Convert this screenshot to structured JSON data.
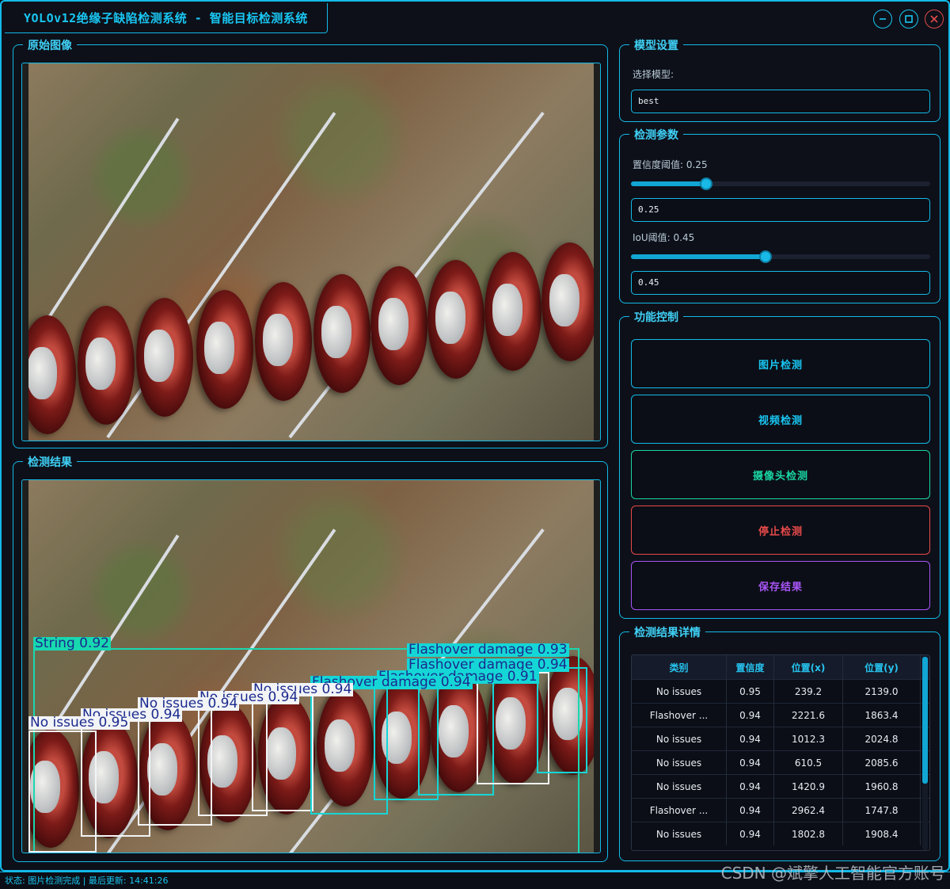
{
  "window": {
    "title": "YOLOv12绝缘子缺陷检测系统 - 智能目标检测系统"
  },
  "left": {
    "original_title": "原始图像",
    "result_title": "检测结果",
    "detections": [
      {
        "label": "String 0.92",
        "style": "mint"
      },
      {
        "label": "Flashover damage 0.93",
        "style": "cyan"
      },
      {
        "label": "Flashover damage 0.94",
        "style": "cyan"
      },
      {
        "label": "Flashover damage 0.91",
        "style": "cyan"
      },
      {
        "label": "Flashover damage 0.94",
        "style": "cyan"
      },
      {
        "label": "No issues 0.94",
        "style": "white"
      },
      {
        "label": "No issues 0.94",
        "style": "white"
      },
      {
        "label": "No issues 0.94",
        "style": "white"
      },
      {
        "label": "No issues 0.94",
        "style": "white"
      },
      {
        "label": "No issues 0.94",
        "style": "white"
      },
      {
        "label": "No issues 0.95",
        "style": "white"
      }
    ]
  },
  "model": {
    "group_title": "模型设置",
    "select_label": "选择模型:",
    "selected": "best"
  },
  "params": {
    "group_title": "检测参数",
    "conf_label": "置信度阈值: 0.25",
    "conf_value": "0.25",
    "conf_fraction": 0.25,
    "iou_label": "IoU阈值: 0.45",
    "iou_value": "0.45",
    "iou_fraction": 0.45
  },
  "controls": {
    "group_title": "功能控制",
    "image_detect": "图片检测",
    "video_detect": "视频检测",
    "camera_detect": "摄像头检测",
    "stop_detect": "停止检测",
    "save_result": "保存结果"
  },
  "details": {
    "group_title": "检测结果详情",
    "columns": [
      "类别",
      "置信度",
      "位置(x)",
      "位置(y)"
    ],
    "rows": [
      [
        "No issues",
        "0.95",
        "239.2",
        "2139.0"
      ],
      [
        "Flashover ...",
        "0.94",
        "2221.6",
        "1863.4"
      ],
      [
        "No issues",
        "0.94",
        "1012.3",
        "2024.8"
      ],
      [
        "No issues",
        "0.94",
        "610.5",
        "2085.6"
      ],
      [
        "No issues",
        "0.94",
        "1420.9",
        "1960.8"
      ],
      [
        "Flashover ...",
        "0.94",
        "2962.4",
        "1747.8"
      ],
      [
        "No issues",
        "0.94",
        "1802.8",
        "1908.4"
      ]
    ]
  },
  "status": {
    "text": "状态: 图片检测完成 | 最后更新: 14:41:26"
  },
  "watermark": "CSDN @斌擎人工智能官方账号",
  "colors": {
    "accent": "#13b9e8",
    "camera": "#19d6a3",
    "stop": "#e84a4a",
    "save": "#a855f7"
  }
}
